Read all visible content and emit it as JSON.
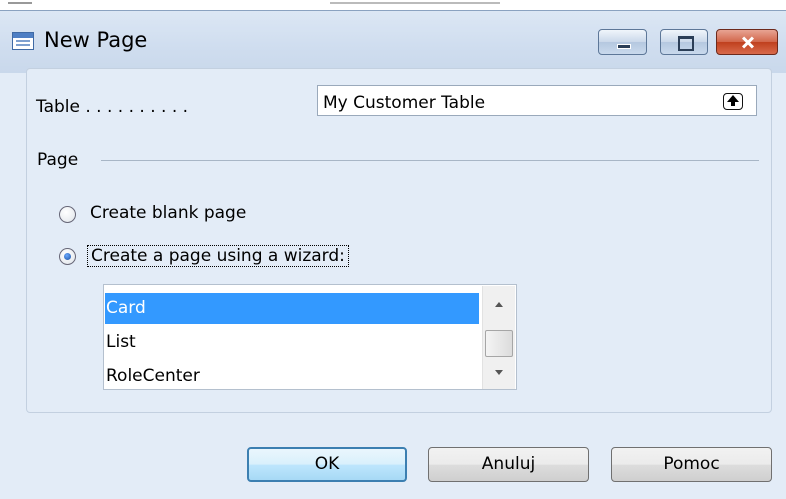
{
  "window": {
    "title": "New Page",
    "controls": [
      "minimize-icon",
      "maximize-icon",
      "close-icon"
    ]
  },
  "table_field": {
    "label": "Table . . . . . . . . . .",
    "value": "My Customer Table",
    "lookup_icon": "lookup-arrow-up-icon"
  },
  "page_group": {
    "label": "Page"
  },
  "options": {
    "blank": {
      "label": "Create blank page",
      "checked": false
    },
    "wizard": {
      "label": "Create a page using a wizard:",
      "checked": true
    }
  },
  "wizard_list": {
    "items": [
      "Card",
      "List",
      "RoleCenter"
    ],
    "selected": "Card"
  },
  "buttons": {
    "ok": "OK",
    "cancel": "Anuluj",
    "help": "Pomoc"
  },
  "colors": {
    "selection": "#3399ff",
    "window_bg": "#e3ecf7",
    "close_button": "#c0401e"
  }
}
